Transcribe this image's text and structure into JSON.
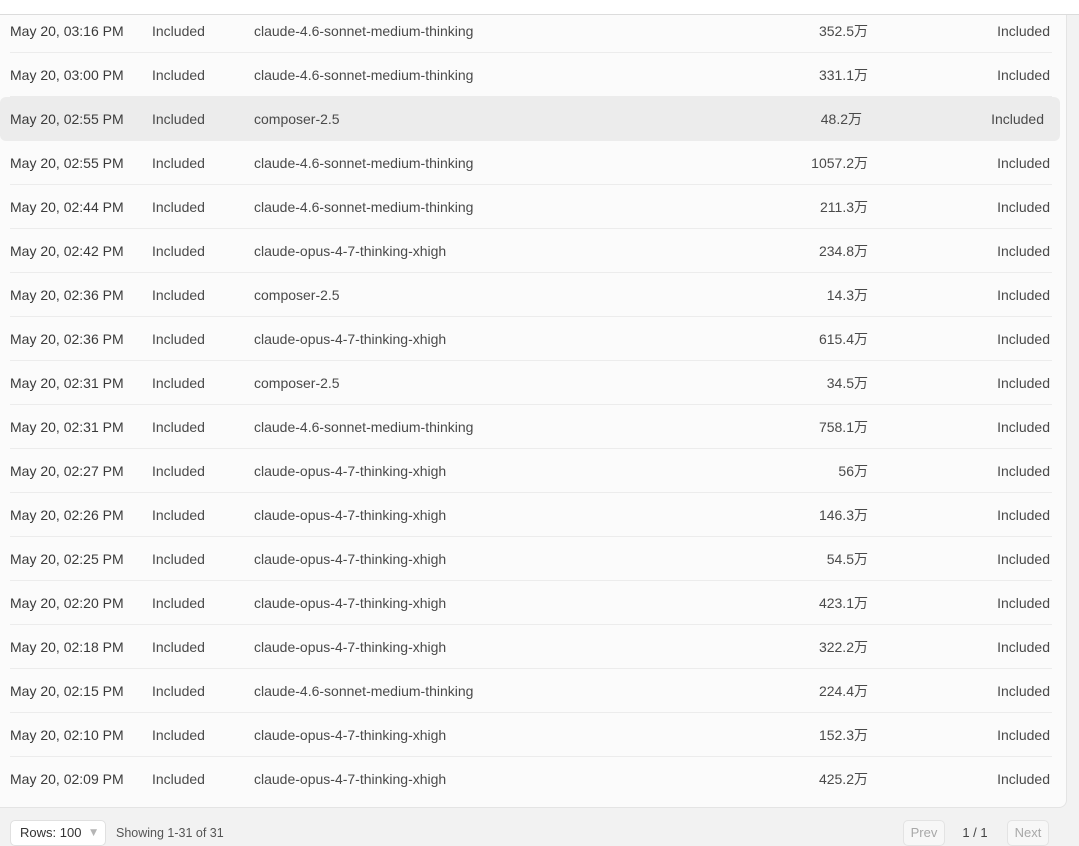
{
  "rows": [
    {
      "date": "May 20, 03:16 PM",
      "kind": "Included",
      "model": "claude-4.6-sonnet-medium-thinking",
      "tokens": "352.5万",
      "cost": "Included"
    },
    {
      "date": "May 20, 03:00 PM",
      "kind": "Included",
      "model": "claude-4.6-sonnet-medium-thinking",
      "tokens": "331.1万",
      "cost": "Included"
    },
    {
      "date": "May 20, 02:55 PM",
      "kind": "Included",
      "model": "composer-2.5",
      "tokens": "48.2万",
      "cost": "Included"
    },
    {
      "date": "May 20, 02:55 PM",
      "kind": "Included",
      "model": "claude-4.6-sonnet-medium-thinking",
      "tokens": "1057.2万",
      "cost": "Included"
    },
    {
      "date": "May 20, 02:44 PM",
      "kind": "Included",
      "model": "claude-4.6-sonnet-medium-thinking",
      "tokens": "211.3万",
      "cost": "Included"
    },
    {
      "date": "May 20, 02:42 PM",
      "kind": "Included",
      "model": "claude-opus-4-7-thinking-xhigh",
      "tokens": "234.8万",
      "cost": "Included"
    },
    {
      "date": "May 20, 02:36 PM",
      "kind": "Included",
      "model": "composer-2.5",
      "tokens": "14.3万",
      "cost": "Included"
    },
    {
      "date": "May 20, 02:36 PM",
      "kind": "Included",
      "model": "claude-opus-4-7-thinking-xhigh",
      "tokens": "615.4万",
      "cost": "Included"
    },
    {
      "date": "May 20, 02:31 PM",
      "kind": "Included",
      "model": "composer-2.5",
      "tokens": "34.5万",
      "cost": "Included"
    },
    {
      "date": "May 20, 02:31 PM",
      "kind": "Included",
      "model": "claude-4.6-sonnet-medium-thinking",
      "tokens": "758.1万",
      "cost": "Included"
    },
    {
      "date": "May 20, 02:27 PM",
      "kind": "Included",
      "model": "claude-opus-4-7-thinking-xhigh",
      "tokens": "56万",
      "cost": "Included"
    },
    {
      "date": "May 20, 02:26 PM",
      "kind": "Included",
      "model": "claude-opus-4-7-thinking-xhigh",
      "tokens": "146.3万",
      "cost": "Included"
    },
    {
      "date": "May 20, 02:25 PM",
      "kind": "Included",
      "model": "claude-opus-4-7-thinking-xhigh",
      "tokens": "54.5万",
      "cost": "Included"
    },
    {
      "date": "May 20, 02:20 PM",
      "kind": "Included",
      "model": "claude-opus-4-7-thinking-xhigh",
      "tokens": "423.1万",
      "cost": "Included"
    },
    {
      "date": "May 20, 02:18 PM",
      "kind": "Included",
      "model": "claude-opus-4-7-thinking-xhigh",
      "tokens": "322.2万",
      "cost": "Included"
    },
    {
      "date": "May 20, 02:15 PM",
      "kind": "Included",
      "model": "claude-4.6-sonnet-medium-thinking",
      "tokens": "224.4万",
      "cost": "Included"
    },
    {
      "date": "May 20, 02:10 PM",
      "kind": "Included",
      "model": "claude-opus-4-7-thinking-xhigh",
      "tokens": "152.3万",
      "cost": "Included"
    },
    {
      "date": "May 20, 02:09 PM",
      "kind": "Included",
      "model": "claude-opus-4-7-thinking-xhigh",
      "tokens": "425.2万",
      "cost": "Included"
    }
  ],
  "highlighted_row": 2,
  "footer": {
    "rows_select": "Rows: 100",
    "chevron_icon": "chevron-down-icon",
    "showing": "Showing 1-31 of 31",
    "prev_label": "Prev",
    "page_indicator": "1 / 1",
    "next_label": "Next"
  },
  "colors": {
    "page_background": "#f2f2f2",
    "table_background": "#fbfbfb",
    "highlight_row": "#ececec",
    "text": "#3c3c3c"
  }
}
